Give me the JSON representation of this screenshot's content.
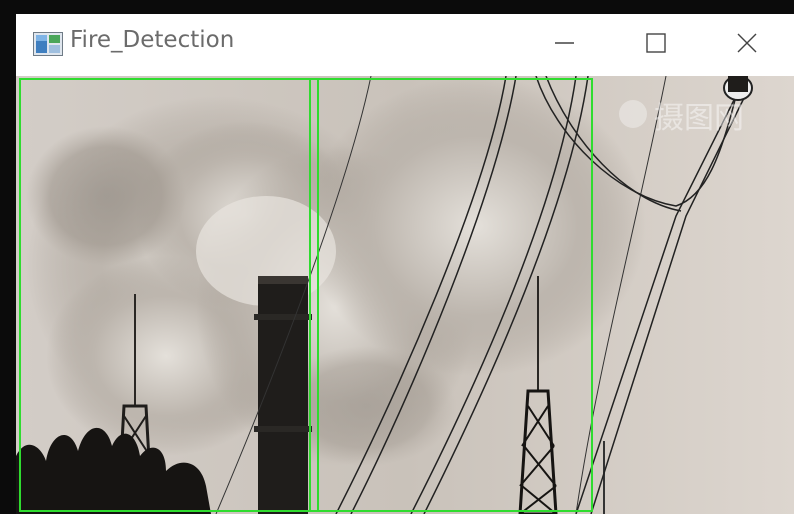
{
  "window": {
    "title": "Fire_Detection",
    "icon": "opencv-window-icon"
  },
  "controls": {
    "minimize_icon": "minimize-icon",
    "maximize_icon": "maximize-icon",
    "close_icon": "close-icon"
  },
  "video": {
    "watermark_text": "摄图网",
    "detections": [
      {
        "label": "detection-box-1",
        "color": "#2fdc2f"
      },
      {
        "label": "detection-box-2",
        "color": "#2fdc2f"
      }
    ]
  }
}
